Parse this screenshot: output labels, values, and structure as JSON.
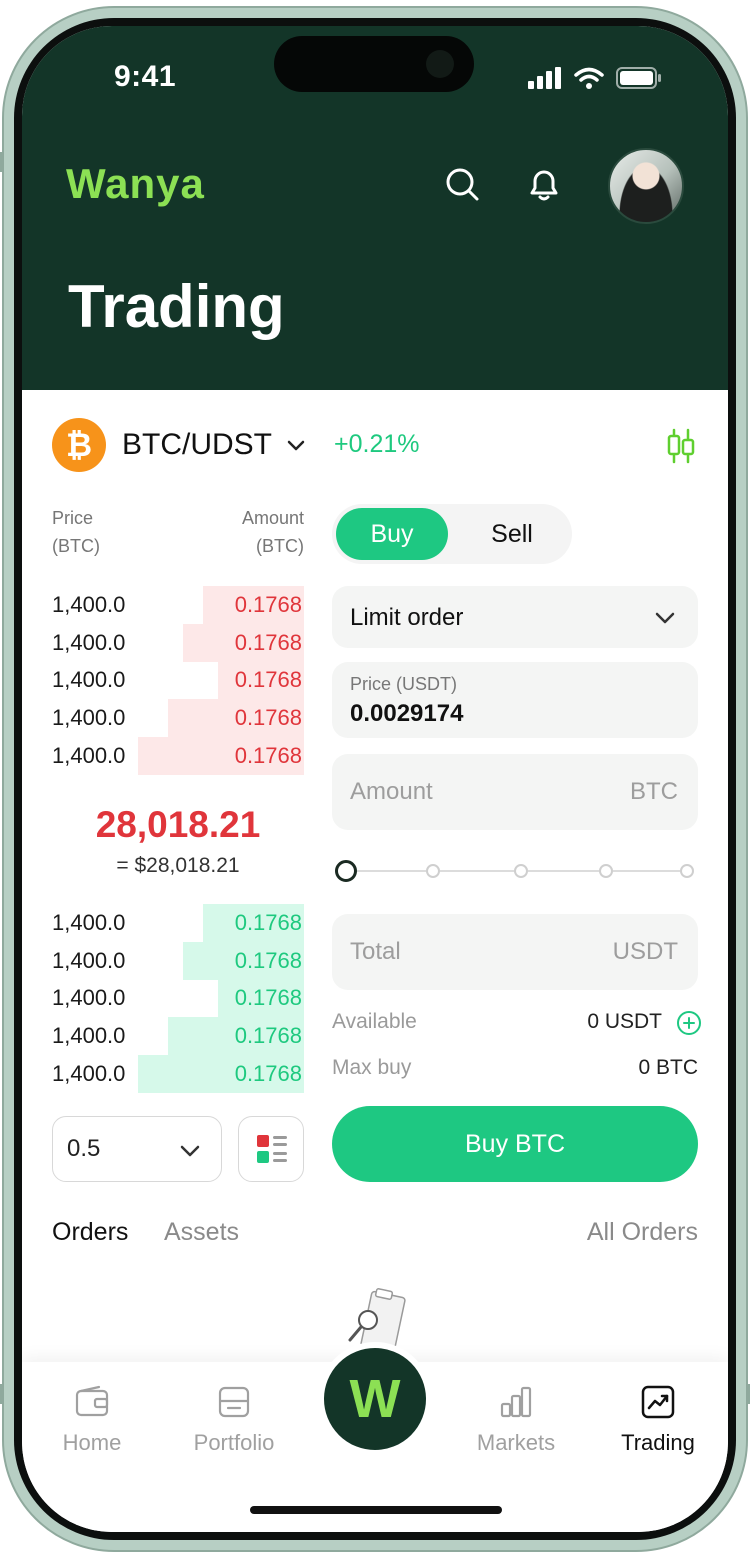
{
  "status_bar": {
    "time": "9:41"
  },
  "header": {
    "logo": "Wanya",
    "title": "Trading"
  },
  "pair": {
    "symbol": "BTC/UDST",
    "change": "+0.21%",
    "coin_glyph": "₿",
    "coin_color": "#f7931a",
    "change_color": "#1ec97f"
  },
  "order_book": {
    "price_header": [
      "Price",
      "(BTC)"
    ],
    "amount_header": [
      "Amount",
      "(BTC)"
    ],
    "asks": [
      {
        "price": "1,400.0",
        "amount": "0.1768",
        "depth": 0.4
      },
      {
        "price": "1,400.0",
        "amount": "0.1768",
        "depth": 0.48
      },
      {
        "price": "1,400.0",
        "amount": "0.1768",
        "depth": 0.34
      },
      {
        "price": "1,400.0",
        "amount": "0.1768",
        "depth": 0.54
      },
      {
        "price": "1,400.0",
        "amount": "0.1768",
        "depth": 0.66
      }
    ],
    "mid_price": "28,018.21",
    "mid_price_usd": "= $28,018.21",
    "bids": [
      {
        "price": "1,400.0",
        "amount": "0.1768",
        "depth": 0.4
      },
      {
        "price": "1,400.0",
        "amount": "0.1768",
        "depth": 0.48
      },
      {
        "price": "1,400.0",
        "amount": "0.1768",
        "depth": 0.34
      },
      {
        "price": "1,400.0",
        "amount": "0.1768",
        "depth": 0.54
      },
      {
        "price": "1,400.0",
        "amount": "0.1768",
        "depth": 0.66
      }
    ],
    "ask_color": "#e0353b",
    "bid_color": "#1ec97f",
    "depth_step": "0.5"
  },
  "trade_form": {
    "buy_label": "Buy",
    "sell_label": "Sell",
    "order_type": "Limit order",
    "price_label": "Price (USDT)",
    "price_value": "0.0029174",
    "amount_placeholder": "Amount",
    "amount_unit": "BTC",
    "amount_slider_percent": 0,
    "total_placeholder": "Total",
    "total_unit": "USDT",
    "available_label": "Available",
    "available_value": "0 USDT",
    "max_buy_label": "Max buy",
    "max_buy_value": "0 BTC",
    "submit_label": "Buy BTC",
    "accent_color": "#1ec882"
  },
  "tabs": {
    "orders": "Orders",
    "assets": "Assets",
    "all_orders": "All Orders"
  },
  "bottom_nav": {
    "home": "Home",
    "portfolio": "Portfolio",
    "center_glyph": "W",
    "markets": "Markets",
    "trading": "Trading",
    "active": "Trading"
  }
}
